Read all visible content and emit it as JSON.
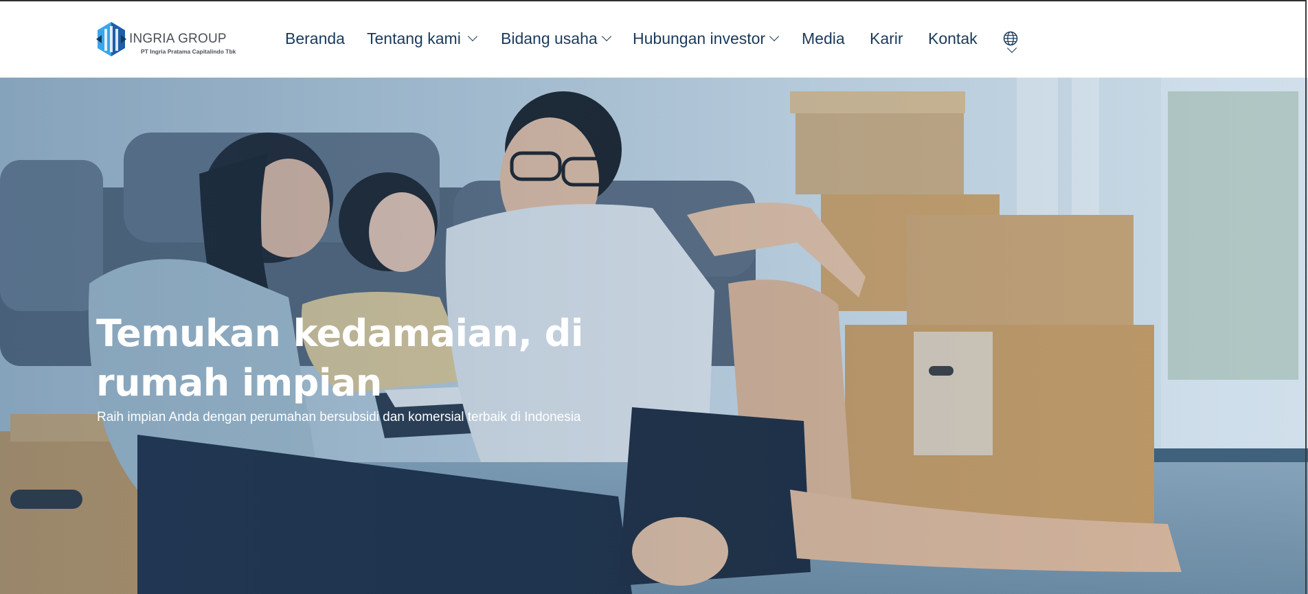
{
  "header": {
    "logo_name": "INGRIA GROUP",
    "logo_subtitle": "PT Ingria Pratama Capitalindo Tbk",
    "nav": [
      {
        "label": "Beranda",
        "dropdown": false
      },
      {
        "label": "Tentang kami",
        "dropdown": true
      },
      {
        "label": "Bidang usaha",
        "dropdown": true
      },
      {
        "label": "Hubungan investor",
        "dropdown": true
      },
      {
        "label": "Media",
        "dropdown": false
      },
      {
        "label": "Karir",
        "dropdown": false
      },
      {
        "label": "Kontak",
        "dropdown": false
      }
    ],
    "language_icon": "globe-icon"
  },
  "hero": {
    "title_line1": "Temukan kedamaian, di",
    "title_line2": "rumah impian",
    "subtitle": "Raih impian Anda dengan perumahan bersubsidi dan komersial terbaik di Indonesia"
  },
  "colors": {
    "nav_text": "#1a3a5c",
    "logo_blue": "#2a8fd6",
    "hero_tint": "#285078"
  }
}
